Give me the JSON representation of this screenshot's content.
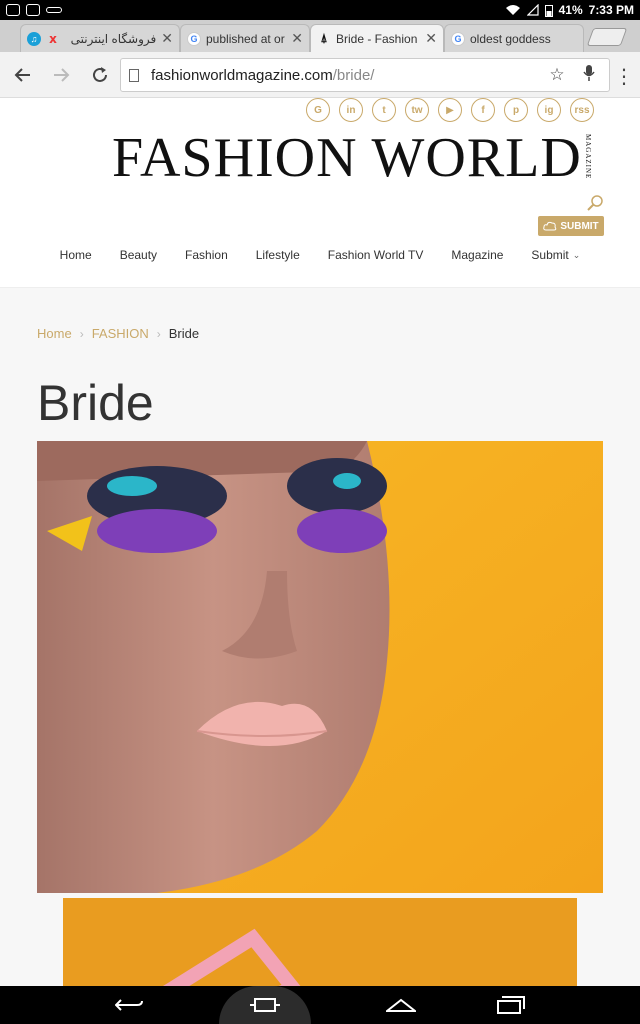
{
  "status": {
    "battery": "41%",
    "time": "7:33 PM"
  },
  "tabs": [
    {
      "title": "فروشگاه اینترنتی",
      "close": "✕"
    },
    {
      "title": "published at or o",
      "close": "✕"
    },
    {
      "title": "Bride - Fashion W",
      "close": "✕"
    },
    {
      "title": "oldest goddess",
      "close": ""
    }
  ],
  "address": {
    "host": "fashionworldmagazine.com",
    "path": "/bride/"
  },
  "site": {
    "logo": "FASHION WORLD",
    "logo_side": "MAGAZINE",
    "submit": "SUBMIT",
    "social": [
      "G",
      "in",
      "t",
      "tw",
      "▶",
      "f",
      "p",
      "ig",
      "rss"
    ],
    "nav": [
      "Home",
      "Beauty",
      "Fashion",
      "Lifestyle",
      "Fashion World TV",
      "Magazine",
      "Submit"
    ]
  },
  "breadcrumb": {
    "home": "Home",
    "section": "FASHION",
    "current": "Bride"
  },
  "page": {
    "title": "Bride"
  },
  "colors": {
    "accent": "#c9a96a",
    "hero_bg": "#f5b223"
  }
}
